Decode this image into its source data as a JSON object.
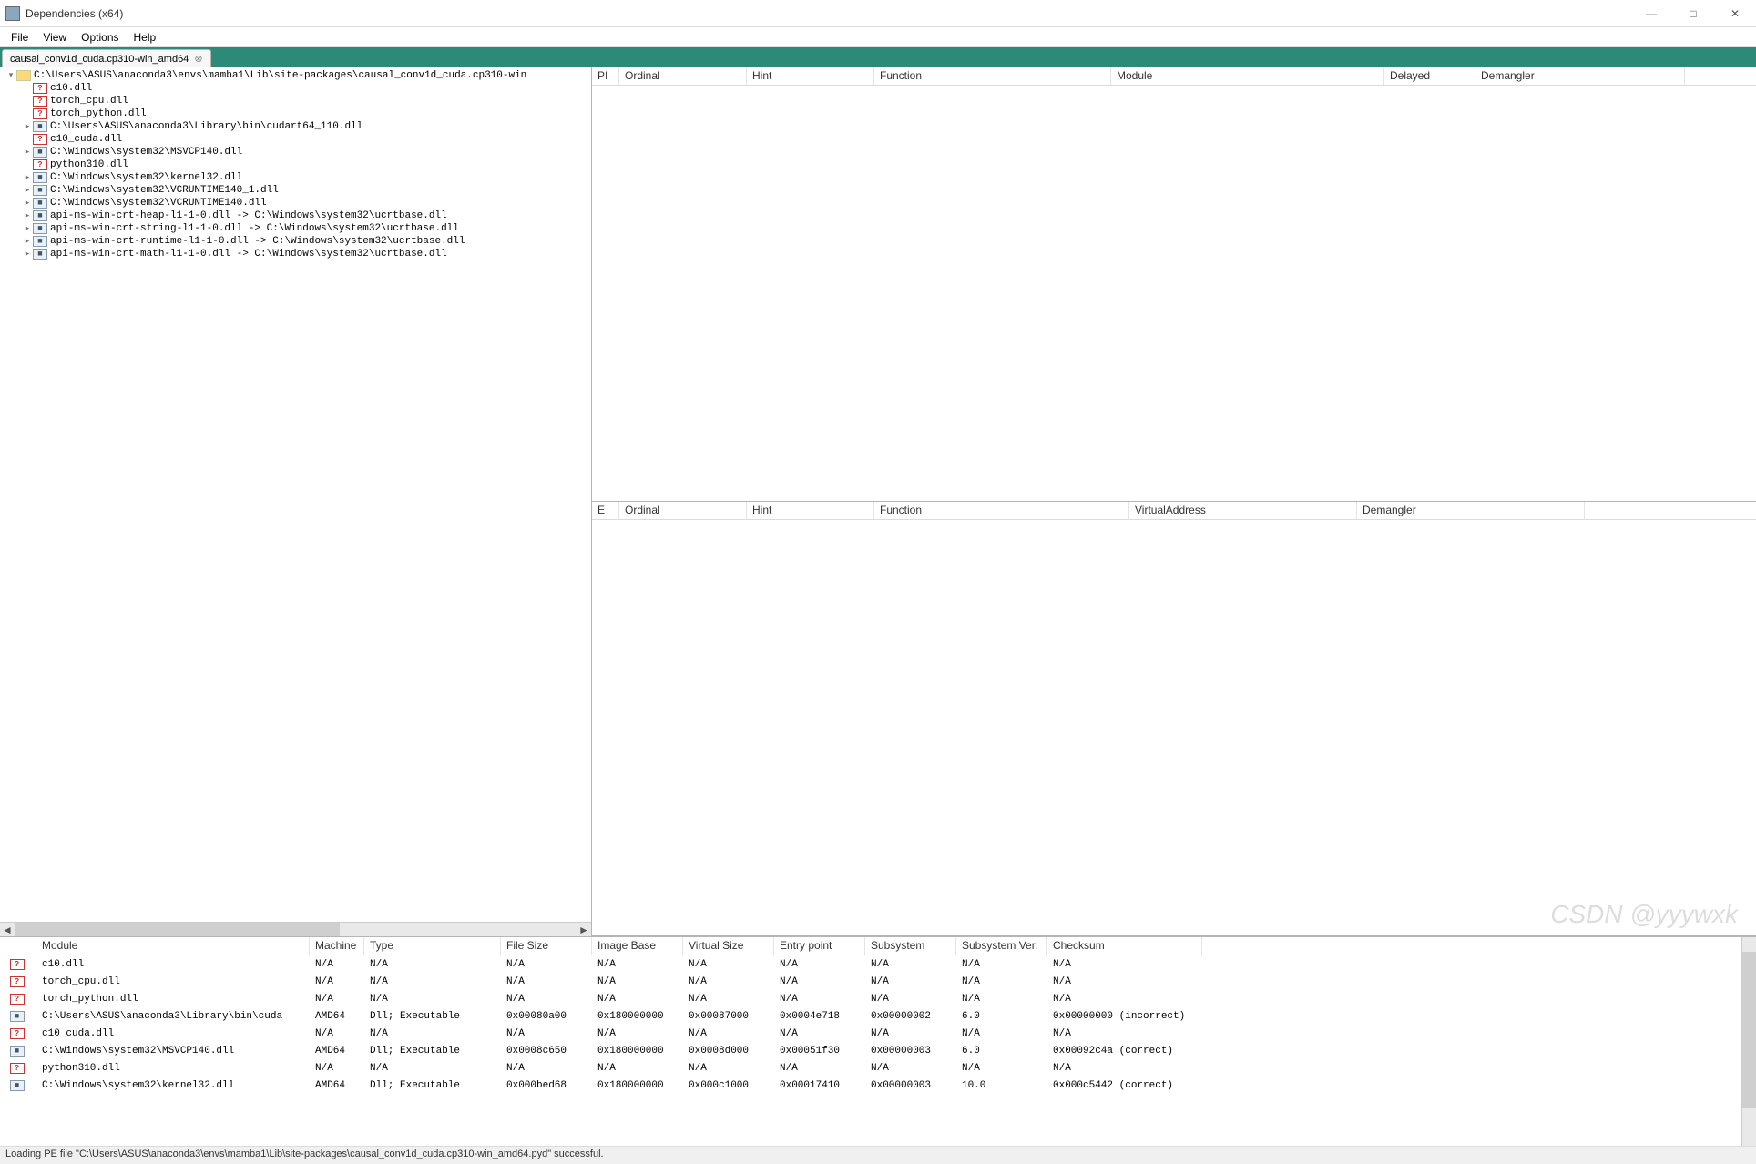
{
  "window": {
    "title": "Dependencies (x64)",
    "buttons": {
      "min": "—",
      "max": "□",
      "close": "✕"
    }
  },
  "menu": {
    "items": [
      "File",
      "View",
      "Options",
      "Help"
    ]
  },
  "tab": {
    "label": "causal_conv1d_cuda.cp310-win_amd64",
    "close": "⊗"
  },
  "tree": [
    {
      "depth": 0,
      "twisty": "▾",
      "icon": "folder",
      "text": "C:\\Users\\ASUS\\anaconda3\\envs\\mamba1\\Lib\\site-packages\\causal_conv1d_cuda.cp310-win"
    },
    {
      "depth": 1,
      "twisty": "",
      "icon": "err",
      "text": "c10.dll"
    },
    {
      "depth": 1,
      "twisty": "",
      "icon": "err",
      "text": "torch_cpu.dll"
    },
    {
      "depth": 1,
      "twisty": "",
      "icon": "err",
      "text": "torch_python.dll"
    },
    {
      "depth": 1,
      "twisty": "▸",
      "icon": "ok",
      "text": "C:\\Users\\ASUS\\anaconda3\\Library\\bin\\cudart64_110.dll"
    },
    {
      "depth": 1,
      "twisty": "",
      "icon": "err",
      "text": "c10_cuda.dll"
    },
    {
      "depth": 1,
      "twisty": "▸",
      "icon": "ok",
      "text": "C:\\Windows\\system32\\MSVCP140.dll"
    },
    {
      "depth": 1,
      "twisty": "",
      "icon": "err",
      "text": "python310.dll"
    },
    {
      "depth": 1,
      "twisty": "▸",
      "icon": "ok",
      "text": "C:\\Windows\\system32\\kernel32.dll"
    },
    {
      "depth": 1,
      "twisty": "▸",
      "icon": "ok",
      "text": "C:\\Windows\\system32\\VCRUNTIME140_1.dll"
    },
    {
      "depth": 1,
      "twisty": "▸",
      "icon": "ok",
      "text": "C:\\Windows\\system32\\VCRUNTIME140.dll"
    },
    {
      "depth": 1,
      "twisty": "▸",
      "icon": "ok",
      "text": "api-ms-win-crt-heap-l1-1-0.dll -> C:\\Windows\\system32\\ucrtbase.dll"
    },
    {
      "depth": 1,
      "twisty": "▸",
      "icon": "ok",
      "text": "api-ms-win-crt-string-l1-1-0.dll -> C:\\Windows\\system32\\ucrtbase.dll"
    },
    {
      "depth": 1,
      "twisty": "▸",
      "icon": "ok",
      "text": "api-ms-win-crt-runtime-l1-1-0.dll -> C:\\Windows\\system32\\ucrtbase.dll"
    },
    {
      "depth": 1,
      "twisty": "▸",
      "icon": "ok",
      "text": "api-ms-win-crt-math-l1-1-0.dll -> C:\\Windows\\system32\\ucrtbase.dll"
    }
  ],
  "imports_hdr": [
    "PI",
    "Ordinal",
    "Hint",
    "Function",
    "Module",
    "Delayed",
    "Demangler"
  ],
  "imports_widths": [
    30,
    140,
    140,
    260,
    300,
    100,
    230
  ],
  "exports_hdr": [
    "E",
    "Ordinal",
    "Hint",
    "Function",
    "VirtualAddress",
    "Demangler"
  ],
  "exports_widths": [
    30,
    140,
    140,
    280,
    250,
    250
  ],
  "modules_hdr": [
    "",
    "Module",
    "Machine",
    "Type",
    "File Size",
    "Image Base",
    "Virtual Size",
    "Entry point",
    "Subsystem",
    "Subsystem Ver.",
    "Checksum"
  ],
  "modules_widths": [
    40,
    300,
    60,
    150,
    100,
    100,
    100,
    100,
    100,
    100,
    170
  ],
  "modules": [
    {
      "icon": "err",
      "module": "c10.dll",
      "machine": "N/A",
      "type": "N/A",
      "fsize": "N/A",
      "ibase": "N/A",
      "vsize": "N/A",
      "entry": "N/A",
      "subsys": "N/A",
      "subver": "N/A",
      "checksum": "N/A"
    },
    {
      "icon": "err",
      "module": "torch_cpu.dll",
      "machine": "N/A",
      "type": "N/A",
      "fsize": "N/A",
      "ibase": "N/A",
      "vsize": "N/A",
      "entry": "N/A",
      "subsys": "N/A",
      "subver": "N/A",
      "checksum": "N/A"
    },
    {
      "icon": "err",
      "module": "torch_python.dll",
      "machine": "N/A",
      "type": "N/A",
      "fsize": "N/A",
      "ibase": "N/A",
      "vsize": "N/A",
      "entry": "N/A",
      "subsys": "N/A",
      "subver": "N/A",
      "checksum": "N/A"
    },
    {
      "icon": "ok",
      "module": "C:\\Users\\ASUS\\anaconda3\\Library\\bin\\cuda",
      "machine": "AMD64",
      "type": "Dll; Executable",
      "fsize": "0x00080a00",
      "ibase": "0x180000000",
      "vsize": "0x00087000",
      "entry": "0x0004e718",
      "subsys": "0x00000002",
      "subver": "6.0",
      "checksum": "0x00000000 (incorrect)"
    },
    {
      "icon": "err",
      "module": "c10_cuda.dll",
      "machine": "N/A",
      "type": "N/A",
      "fsize": "N/A",
      "ibase": "N/A",
      "vsize": "N/A",
      "entry": "N/A",
      "subsys": "N/A",
      "subver": "N/A",
      "checksum": "N/A"
    },
    {
      "icon": "ok",
      "module": "C:\\Windows\\system32\\MSVCP140.dll",
      "machine": "AMD64",
      "type": "Dll; Executable",
      "fsize": "0x0008c650",
      "ibase": "0x180000000",
      "vsize": "0x0008d000",
      "entry": "0x00051f30",
      "subsys": "0x00000003",
      "subver": "6.0",
      "checksum": "0x00092c4a (correct)"
    },
    {
      "icon": "err",
      "module": "python310.dll",
      "machine": "N/A",
      "type": "N/A",
      "fsize": "N/A",
      "ibase": "N/A",
      "vsize": "N/A",
      "entry": "N/A",
      "subsys": "N/A",
      "subver": "N/A",
      "checksum": "N/A"
    },
    {
      "icon": "ok",
      "module": "C:\\Windows\\system32\\kernel32.dll",
      "machine": "AMD64",
      "type": "Dll; Executable",
      "fsize": "0x000bed68",
      "ibase": "0x180000000",
      "vsize": "0x000c1000",
      "entry": "0x00017410",
      "subsys": "0x00000003",
      "subver": "10.0",
      "checksum": "0x000c5442 (correct)"
    }
  ],
  "statusbar": "Loading PE file \"C:\\Users\\ASUS\\anaconda3\\envs\\mamba1\\Lib\\site-packages\\causal_conv1d_cuda.cp310-win_amd64.pyd\" successful.",
  "watermark": "CSDN @yyywxk"
}
